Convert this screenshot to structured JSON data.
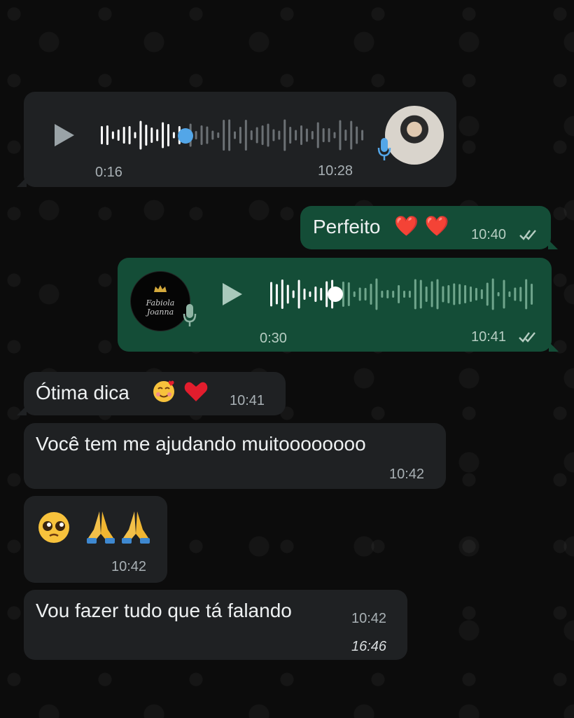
{
  "messages": [
    {
      "type": "voice-in",
      "duration": "0:16",
      "time": "10:28",
      "progress": 0.33
    },
    {
      "type": "text-out",
      "text": "Perfeito",
      "emoji": "❤️ ❤️",
      "time": "10:40"
    },
    {
      "type": "voice-out",
      "duration": "0:30",
      "time": "10:41",
      "progress": 0.25,
      "avatar_caption": "Fabiola Joanna"
    },
    {
      "type": "text-in",
      "text": "Ótima dica",
      "time": "10:41"
    },
    {
      "type": "text-in",
      "text": "Você tem me ajudando muitoooooooo",
      "time": "10:42"
    },
    {
      "type": "emoji-in",
      "time": "10:42"
    },
    {
      "type": "text-in",
      "text": "Vou fazer tudo que tá falando",
      "time": "10:42",
      "watermark": "16:46"
    }
  ],
  "colors": {
    "incoming": "#1f2123",
    "outgoing": "#144d37",
    "accent_blue": "#53a6e8",
    "background": "#0c0c0c"
  },
  "icons": [
    "play-icon",
    "microphone-icon",
    "double-check-icon",
    "red-heart-emoji",
    "smiling-hearts-emoji",
    "pleading-face-emoji",
    "folded-hands-emoji"
  ]
}
